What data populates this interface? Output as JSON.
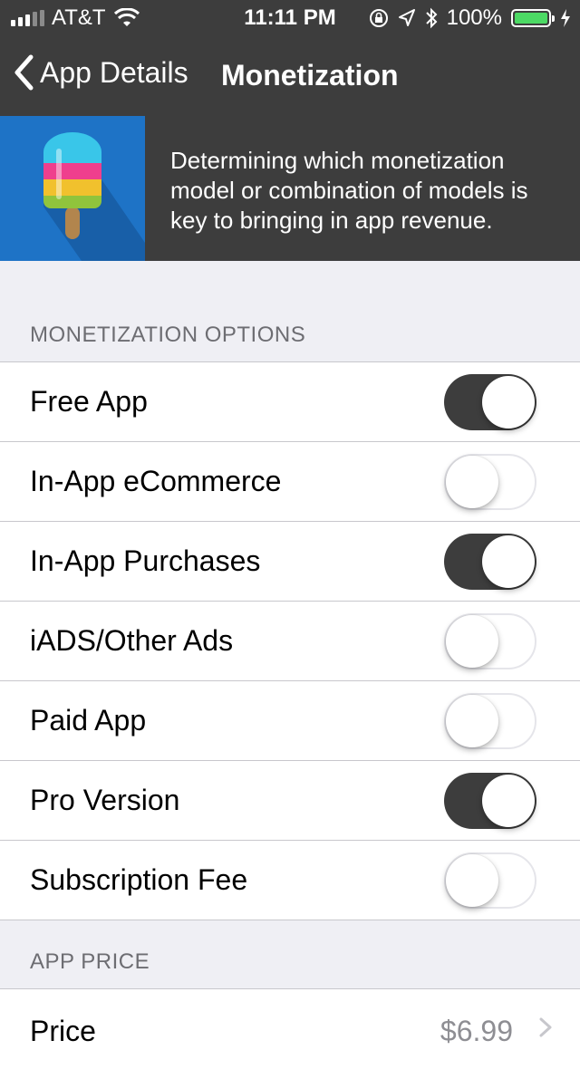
{
  "status": {
    "carrier": "AT&T",
    "time": "11:11 PM",
    "battery_text": "100%",
    "battery_level": 1.0,
    "battery_color": "#4cd964"
  },
  "nav": {
    "back_label": "App Details",
    "title": "Monetization"
  },
  "banner": {
    "description": "Determining which monetization model or combination of models is key to bringing in app revenue.",
    "icon": "popsicle-icon"
  },
  "monetization": {
    "header": "MONETIZATION OPTIONS",
    "options": [
      {
        "label": "Free App",
        "enabled": true
      },
      {
        "label": "In-App eCommerce",
        "enabled": false
      },
      {
        "label": "In-App Purchases",
        "enabled": true
      },
      {
        "label": "iADS/Other Ads",
        "enabled": false
      },
      {
        "label": "Paid App",
        "enabled": false
      },
      {
        "label": "Pro Version",
        "enabled": true
      },
      {
        "label": "Subscription Fee",
        "enabled": false
      }
    ]
  },
  "price_section": {
    "header": "APP PRICE",
    "price_label": "Price",
    "price_value": "$6.99"
  },
  "colors": {
    "nav_bg": "#3d3d3d",
    "toggle_on": "#3d3d3d",
    "banner_art_bg": "#1e73c6"
  }
}
